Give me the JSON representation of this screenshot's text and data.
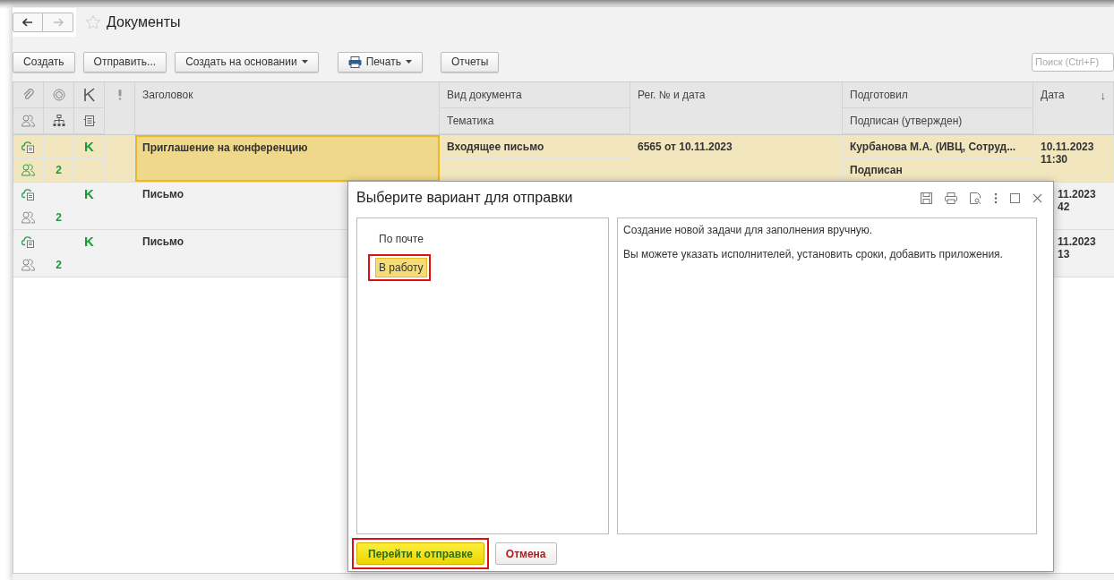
{
  "window": {
    "title": "Документы",
    "favorite": false
  },
  "toolbar": {
    "buttons": [
      {
        "label": "Создать",
        "kind": "plain"
      },
      {
        "label": "Отправить...",
        "kind": "plain"
      },
      {
        "label": "Создать на основании",
        "kind": "dropdown"
      },
      {
        "label": "Печать",
        "kind": "print"
      },
      {
        "label": "Отчеты",
        "kind": "plain"
      }
    ],
    "search": {
      "placeholder": "Поиск (Ctrl+F)"
    }
  },
  "table": {
    "columns": {
      "title": "Заголовок",
      "doc_type": "Вид документа",
      "topic": "Тематика",
      "reg": "Рег. № и дата",
      "author": "Подготовил",
      "signed": "Подписан (утвержден)",
      "date": "Дата",
      "sort": "↓"
    },
    "rows": [
      {
        "selected": true,
        "covered": false,
        "k": "K",
        "count": "2",
        "participants_active": true,
        "title": "Приглашение на конференцию",
        "doc_type": "Входящее письмо",
        "reg": "6565 от 10.11.2023",
        "author": "Курбанова М.А. (ИВЦ, Сотруд...",
        "signed": "Подписан",
        "date": "10.11.2023",
        "time": "11:30"
      },
      {
        "selected": false,
        "covered": true,
        "k": "K",
        "count": "2",
        "participants_active": false,
        "title": "Письмо",
        "date": "11.2023",
        "time": "42"
      },
      {
        "selected": false,
        "covered": true,
        "k": "K",
        "count": "2",
        "participants_active": false,
        "title": "Письмо",
        "date": "11.2023",
        "time": "13"
      }
    ]
  },
  "dialog": {
    "title": "Выберите вариант для отправки",
    "options": [
      {
        "label": "По почте",
        "selected": false,
        "highlighted": false
      },
      {
        "label": "В работу",
        "selected": true,
        "highlighted": true
      }
    ],
    "description": [
      "Создание новой задачи для заполнения вручную.",
      "Вы можете указать исполнителей, установить сроки, добавить приложения."
    ],
    "buttons": [
      {
        "label": "Перейти к отправке",
        "kind": "primary",
        "highlighted": true
      },
      {
        "label": "Отмена",
        "kind": "cancel",
        "highlighted": false
      }
    ]
  }
}
